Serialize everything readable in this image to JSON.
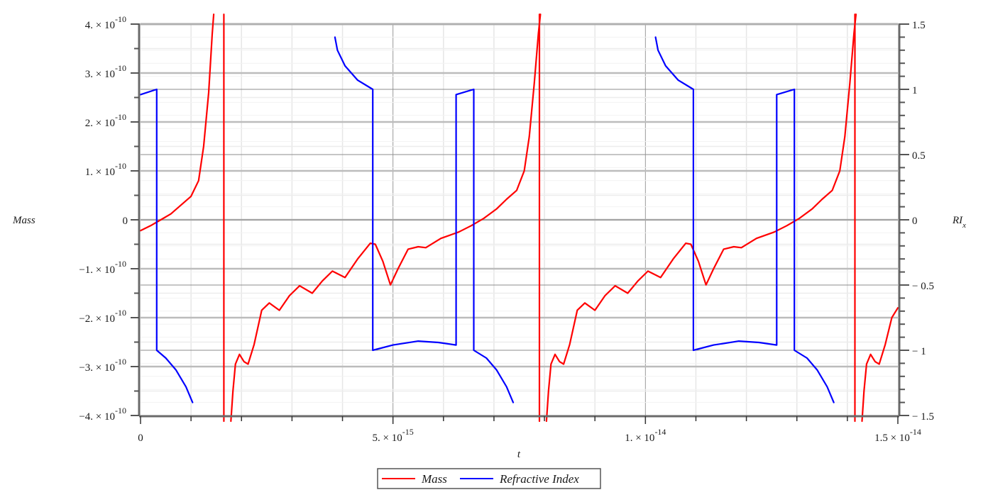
{
  "chart_data": {
    "type": "line",
    "title": "",
    "xlabel": "t",
    "ylabel": "Mass",
    "y2label": "RI",
    "y2label_subscript": "x",
    "xlim": [
      0,
      1.5e-14
    ],
    "ylim": [
      -4e-10,
      4e-10
    ],
    "y2lim": [
      -1.5,
      1.5
    ],
    "grid": true,
    "legend_position": "bottom-center",
    "x_ticks": [
      {
        "value": 0,
        "mantissa": "0",
        "exponent": ""
      },
      {
        "value": 5e-15,
        "mantissa": "5. × 10",
        "exponent": "-15"
      },
      {
        "value": 1e-14,
        "mantissa": "1. × 10",
        "exponent": "-14"
      },
      {
        "value": 1.5e-14,
        "mantissa": "1.5 × 10",
        "exponent": "-14"
      }
    ],
    "y_ticks": [
      {
        "value": 4e-10,
        "mantissa": "4. × 10",
        "exponent": "-10"
      },
      {
        "value": 3e-10,
        "mantissa": "3. × 10",
        "exponent": "-10"
      },
      {
        "value": 2e-10,
        "mantissa": "2. × 10",
        "exponent": "-10"
      },
      {
        "value": 1e-10,
        "mantissa": "1. × 10",
        "exponent": "-10"
      },
      {
        "value": 0,
        "mantissa": "0",
        "exponent": ""
      },
      {
        "value": -1e-10,
        "mantissa": "−1. × 10",
        "exponent": "-10"
      },
      {
        "value": -2e-10,
        "mantissa": "−2. × 10",
        "exponent": "-10"
      },
      {
        "value": -3e-10,
        "mantissa": "−3. × 10",
        "exponent": "-10"
      },
      {
        "value": -4e-10,
        "mantissa": "−4. × 10",
        "exponent": "-10"
      }
    ],
    "y2_ticks": [
      {
        "value": 1.5,
        "label": "1.5"
      },
      {
        "value": 1,
        "label": "1"
      },
      {
        "value": 0.5,
        "label": "0.5"
      },
      {
        "value": 0,
        "label": "0"
      },
      {
        "value": -0.5,
        "label": "− 0.5"
      },
      {
        "value": -1,
        "label": "− 1"
      },
      {
        "value": -1.5,
        "label": "− 1.5"
      }
    ],
    "series": [
      {
        "name": "Mass",
        "axis": "left",
        "color": "#ff0000",
        "segments": [
          [
            [
              0,
              -2.2e-11
            ],
            [
              2e-16,
              -1.2e-11
            ],
            [
              4e-16,
              0.0
            ],
            [
              6e-16,
              1.2e-11
            ],
            [
              8e-16,
              3e-11
            ],
            [
              1e-15,
              4.8e-11
            ],
            [
              1.15e-15,
              8e-11
            ],
            [
              1.25e-15,
              1.5e-10
            ],
            [
              1.35e-15,
              2.6e-10
            ],
            [
              1.42e-15,
              3.8e-10
            ],
            [
              1.45e-15,
              4.2e-10
            ]
          ],
          [
            [
              1.65e-15,
              4.2e-10
            ],
            [
              1.65e-15,
              -4.2e-10
            ]
          ],
          [
            [
              1.79e-15,
              -4.2e-10
            ],
            [
              1.83e-15,
              -3.5e-10
            ],
            [
              1.88e-15,
              -2.95e-10
            ],
            [
              1.96e-15,
              -2.75e-10
            ],
            [
              2.05e-15,
              -2.9e-10
            ],
            [
              2.13e-15,
              -2.95e-10
            ],
            [
              2.25e-15,
              -2.55e-10
            ],
            [
              2.4e-15,
              -1.85e-10
            ],
            [
              2.55e-15,
              -1.7e-10
            ],
            [
              2.75e-15,
              -1.85e-10
            ],
            [
              2.95e-15,
              -1.55e-10
            ],
            [
              3.15e-15,
              -1.35e-10
            ],
            [
              3.4e-15,
              -1.5e-10
            ],
            [
              3.6e-15,
              -1.25e-10
            ],
            [
              3.8e-15,
              -1.05e-10
            ],
            [
              4.05e-15,
              -1.18e-10
            ],
            [
              4.3e-15,
              -8e-11
            ],
            [
              4.55e-15,
              -4.8e-11
            ],
            [
              4.65e-15,
              -5e-11
            ],
            [
              4.8e-15,
              -8.5e-11
            ],
            [
              4.95e-15,
              -1.33e-10
            ],
            [
              5.1e-15,
              -1e-10
            ],
            [
              5.3e-15,
              -6e-11
            ],
            [
              5.5e-15,
              -5.5e-11
            ],
            [
              5.65e-15,
              -5.7e-11
            ],
            [
              5.95e-15,
              -3.8e-11
            ],
            [
              6.3e-15,
              -2.5e-11
            ],
            [
              6.55e-15,
              -1.2e-11
            ],
            [
              6.8e-15,
              3e-12
            ],
            [
              7.05e-15,
              2.2e-11
            ],
            [
              7.25e-15,
              4.2e-11
            ],
            [
              7.45e-15,
              6e-11
            ],
            [
              7.6e-15,
              1e-10
            ],
            [
              7.7e-15,
              1.7e-10
            ],
            [
              7.8e-15,
              2.8e-10
            ],
            [
              7.88e-15,
              3.8e-10
            ],
            [
              7.92e-15,
              4.2e-10
            ]
          ],
          [
            [
              7.9e-15,
              4.2e-10
            ],
            [
              7.9e-15,
              -4.2e-10
            ]
          ],
          [
            [
              8.04e-15,
              -4.2e-10
            ],
            [
              8.08e-15,
              -3.5e-10
            ],
            [
              8.13e-15,
              -2.95e-10
            ],
            [
              8.21e-15,
              -2.75e-10
            ],
            [
              8.3e-15,
              -2.9e-10
            ],
            [
              8.38e-15,
              -2.95e-10
            ],
            [
              8.5e-15,
              -2.55e-10
            ],
            [
              8.65e-15,
              -1.85e-10
            ],
            [
              8.8e-15,
              -1.7e-10
            ],
            [
              9e-15,
              -1.85e-10
            ],
            [
              9.2e-15,
              -1.55e-10
            ],
            [
              9.4e-15,
              -1.35e-10
            ],
            [
              9.65e-15,
              -1.5e-10
            ],
            [
              9.85e-15,
              -1.25e-10
            ],
            [
              1.005e-14,
              -1.05e-10
            ],
            [
              1.03e-14,
              -1.18e-10
            ],
            [
              1.055e-14,
              -8e-11
            ],
            [
              1.08e-14,
              -4.8e-11
            ],
            [
              1.09e-14,
              -5e-11
            ],
            [
              1.105e-14,
              -8.5e-11
            ],
            [
              1.12e-14,
              -1.33e-10
            ],
            [
              1.135e-14,
              -1e-10
            ],
            [
              1.155e-14,
              -6e-11
            ],
            [
              1.175e-14,
              -5.5e-11
            ],
            [
              1.19e-14,
              -5.7e-11
            ],
            [
              1.22e-14,
              -3.8e-11
            ],
            [
              1.255e-14,
              -2.5e-11
            ],
            [
              1.28e-14,
              -1.2e-11
            ],
            [
              1.305e-14,
              3e-12
            ],
            [
              1.33e-14,
              2.2e-11
            ],
            [
              1.35e-14,
              4.2e-11
            ],
            [
              1.37e-14,
              6e-11
            ],
            [
              1.385e-14,
              1e-10
            ],
            [
              1.395e-14,
              1.7e-10
            ],
            [
              1.405e-14,
              2.8e-10
            ],
            [
              1.413e-14,
              3.8e-10
            ],
            [
              1.417e-14,
              4.2e-10
            ]
          ],
          [
            [
              1.415e-14,
              4.2e-10
            ],
            [
              1.415e-14,
              -4.2e-10
            ]
          ],
          [
            [
              1.429e-14,
              -4.2e-10
            ],
            [
              1.433e-14,
              -3.5e-10
            ],
            [
              1.438e-14,
              -2.95e-10
            ],
            [
              1.446e-14,
              -2.75e-10
            ],
            [
              1.455e-14,
              -2.9e-10
            ],
            [
              1.463e-14,
              -2.95e-10
            ],
            [
              1.475e-14,
              -2.55e-10
            ],
            [
              1.488e-14,
              -2e-10
            ],
            [
              1.5e-14,
              -1.8e-10
            ]
          ]
        ]
      },
      {
        "name": "Refractive Index",
        "axis": "right",
        "color": "#0000ff",
        "segments": [
          [
            [
              0,
              0.96
            ],
            [
              3.2e-16,
              1.0
            ],
            [
              3.2e-16,
              -1.0
            ],
            [
              5e-16,
              -1.06
            ],
            [
              7e-16,
              -1.15
            ],
            [
              9e-16,
              -1.28
            ],
            [
              1.03e-15,
              -1.4
            ]
          ],
          [
            [
              3.85e-15,
              1.4
            ],
            [
              3.9e-15,
              1.3
            ],
            [
              4.05e-15,
              1.18
            ],
            [
              4.3e-15,
              1.07
            ],
            [
              4.6e-15,
              1.0
            ],
            [
              4.6e-15,
              -1.0
            ],
            [
              5e-15,
              -0.96
            ],
            [
              5.5e-15,
              -0.93
            ],
            [
              5.9e-15,
              -0.94
            ],
            [
              6.25e-15,
              -0.96
            ],
            [
              6.25e-15,
              0.96
            ],
            [
              6.6e-15,
              1.0
            ],
            [
              6.6e-15,
              -1.0
            ],
            [
              6.85e-15,
              -1.06
            ],
            [
              7.05e-15,
              -1.15
            ],
            [
              7.25e-15,
              -1.28
            ],
            [
              7.38e-15,
              -1.4
            ]
          ],
          [
            [
              1.02e-14,
              1.4
            ],
            [
              1.025e-14,
              1.3
            ],
            [
              1.04e-14,
              1.18
            ],
            [
              1.065e-14,
              1.07
            ],
            [
              1.095e-14,
              1.0
            ],
            [
              1.095e-14,
              -1.0
            ],
            [
              1.135e-14,
              -0.96
            ],
            [
              1.185e-14,
              -0.93
            ],
            [
              1.225e-14,
              -0.94
            ],
            [
              1.26e-14,
              -0.96
            ],
            [
              1.26e-14,
              0.96
            ],
            [
              1.295e-14,
              1.0
            ],
            [
              1.295e-14,
              -1.0
            ],
            [
              1.32e-14,
              -1.06
            ],
            [
              1.34e-14,
              -1.15
            ],
            [
              1.36e-14,
              -1.28
            ],
            [
              1.373e-14,
              -1.4
            ]
          ]
        ]
      }
    ],
    "legend": [
      {
        "label": "Mass",
        "color": "#ff0000"
      },
      {
        "label": "Refractive Index",
        "color": "#0000ff"
      }
    ]
  }
}
